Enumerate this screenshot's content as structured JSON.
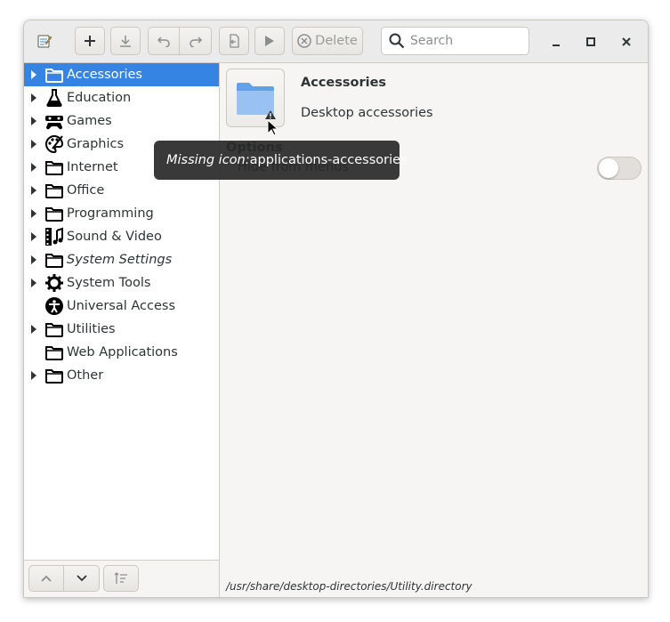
{
  "toolbar": {
    "new_tooltip": "New",
    "delete_label": "Delete",
    "search_placeholder": "Search"
  },
  "sidebar": {
    "items": [
      {
        "label": "Accessories",
        "icon": "folder-icon",
        "expandable": true,
        "selected": true,
        "italic": false
      },
      {
        "label": "Education",
        "icon": "flask-icon",
        "expandable": true,
        "selected": false,
        "italic": false
      },
      {
        "label": "Games",
        "icon": "gamepad-icon",
        "expandable": true,
        "selected": false,
        "italic": false
      },
      {
        "label": "Graphics",
        "icon": "palette-icon",
        "expandable": true,
        "selected": false,
        "italic": false
      },
      {
        "label": "Internet",
        "icon": "folder-icon",
        "expandable": true,
        "selected": false,
        "italic": false
      },
      {
        "label": "Office",
        "icon": "folder-icon",
        "expandable": true,
        "selected": false,
        "italic": false
      },
      {
        "label": "Programming",
        "icon": "folder-icon",
        "expandable": true,
        "selected": false,
        "italic": false
      },
      {
        "label": "Sound & Video",
        "icon": "film-music-icon",
        "expandable": true,
        "selected": false,
        "italic": false
      },
      {
        "label": "System Settings",
        "icon": "folder-icon",
        "expandable": true,
        "selected": false,
        "italic": true
      },
      {
        "label": "System Tools",
        "icon": "gear-icon",
        "expandable": true,
        "selected": false,
        "italic": false
      },
      {
        "label": "Universal Access",
        "icon": "accessibility-icon",
        "expandable": false,
        "selected": false,
        "italic": false
      },
      {
        "label": "Utilities",
        "icon": "folder-icon",
        "expandable": true,
        "selected": false,
        "italic": false
      },
      {
        "label": "Web Applications",
        "icon": "folder-icon",
        "expandable": false,
        "selected": false,
        "italic": false
      },
      {
        "label": "Other",
        "icon": "folder-icon",
        "expandable": true,
        "selected": false,
        "italic": false
      }
    ]
  },
  "detail": {
    "name": "Accessories",
    "comment": "Desktop accessories",
    "options_heading": "Options",
    "hide_from_menus_label": "Hide from menus",
    "hide_from_menus": false,
    "file_path": "/usr/share/desktop-directories/Utility.directory"
  },
  "tooltip": {
    "prefix": "Missing icon:",
    "icon_name": " applications-accessories"
  },
  "colors": {
    "accent": "#3584e4",
    "folder": "#8fbdf2"
  }
}
